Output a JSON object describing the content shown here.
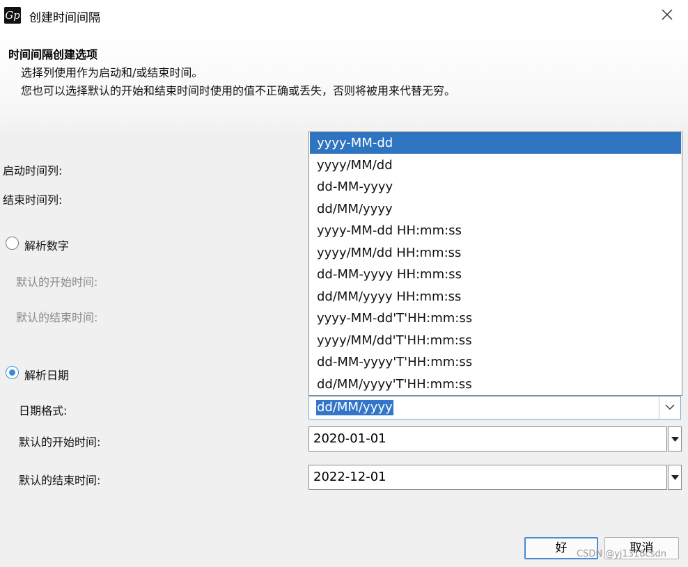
{
  "window": {
    "title": "创建时间间隔",
    "app_icon_text": "Gp"
  },
  "header": {
    "title": "时间间隔创建选项",
    "line1": "选择列使用作为启动和/或结束时间。",
    "line2": "您也可以选择默认的开始和结束时间时使用的值不正确或丢失，否则将被用来代替无穷。"
  },
  "form": {
    "start_col_label": "启动时间列:",
    "end_col_label": "结束时间列:",
    "parse_number": {
      "label": "解析数字",
      "checked": false,
      "default_start_label": "默认的开始时间:",
      "default_end_label": "默认的结束时间:"
    },
    "parse_date": {
      "label": "解析日期",
      "checked": true,
      "format_label": "日期格式:",
      "format_value": "dd/MM/yyyy",
      "default_start_label": "默认的开始时间:",
      "default_start_value": "2020-01-01",
      "default_end_label": "默认的结束时间:",
      "default_end_value": "2022-12-01"
    }
  },
  "dropdown": {
    "options": [
      "yyyy-MM-dd",
      "yyyy/MM/dd",
      "dd-MM-yyyy",
      "dd/MM/yyyy",
      "yyyy-MM-dd HH:mm:ss",
      "yyyy/MM/dd HH:mm:ss",
      "dd-MM-yyyy HH:mm:ss",
      "dd/MM/yyyy HH:mm:ss",
      "yyyy-MM-dd'T'HH:mm:ss",
      "yyyy/MM/dd'T'HH:mm:ss",
      "dd-MM-yyyy'T'HH:mm:ss",
      "dd/MM/yyyy'T'HH:mm:ss"
    ],
    "highlighted": "yyyy-MM-dd"
  },
  "buttons": {
    "ok": "好",
    "cancel": "取消"
  },
  "watermark": "CSDN @yj1318csdn",
  "colors": {
    "accent": "#2f74c1",
    "radio_accent": "#3c8ad8"
  }
}
